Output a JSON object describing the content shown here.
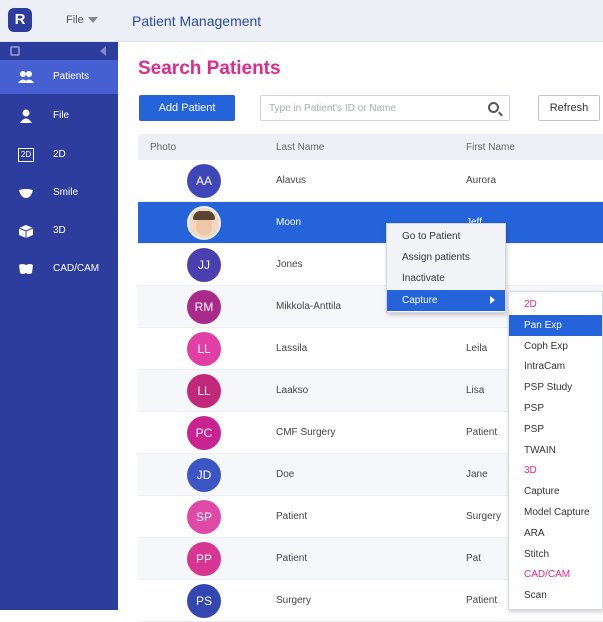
{
  "topbar": {
    "logo": "R",
    "file_menu": "File",
    "app_title": "Patient Management"
  },
  "sidebar": {
    "items": [
      {
        "label": "Patients",
        "icon": "people-icon",
        "active": true
      },
      {
        "label": "File",
        "icon": "person-icon",
        "active": false
      },
      {
        "label": "2D",
        "icon": "2d-icon",
        "active": false
      },
      {
        "label": "Smile",
        "icon": "smile-icon",
        "active": false
      },
      {
        "label": "3D",
        "icon": "3d-icon",
        "active": false
      },
      {
        "label": "CAD/CAM",
        "icon": "cadcam-icon",
        "active": false
      }
    ],
    "icon_text": {
      "2d": "2D"
    }
  },
  "main": {
    "title": "Search Patients",
    "add_patient_label": "Add Patient",
    "search_placeholder": "Type in Patient's ID or Name",
    "refresh_label": "Refresh",
    "columns": [
      "Photo",
      "Last Name",
      "First Name"
    ],
    "rows": [
      {
        "initials": "AA",
        "last": "Alavus",
        "first": "Aurora",
        "color": "#3f47b8"
      },
      {
        "initials": "",
        "last": "Moon",
        "first": "Jeff",
        "color": "#f4d7bf",
        "photo": true
      },
      {
        "initials": "JJ",
        "last": "Jones",
        "first": "",
        "color": "#4a3fb0"
      },
      {
        "initials": "RM",
        "last": "Mikkola-Anttila",
        "first": "",
        "color": "#a92a8a"
      },
      {
        "initials": "LL",
        "last": "Lassila",
        "first": "Leila",
        "color": "#e23fa6"
      },
      {
        "initials": "LL",
        "last": "Laakso",
        "first": "Lisa",
        "color": "#c2287a"
      },
      {
        "initials": "PC",
        "last": "CMF Surgery",
        "first": "Patient",
        "color": "#c92392"
      },
      {
        "initials": "JD",
        "last": "Doe",
        "first": "Jane",
        "color": "#3b56c4"
      },
      {
        "initials": "SP",
        "last": "Patient",
        "first": "Surgery",
        "color": "#e04aa6"
      },
      {
        "initials": "PP",
        "last": "Patient",
        "first": "Pat",
        "color": "#d83592"
      },
      {
        "initials": "PS",
        "last": "Surgery",
        "first": "Patient",
        "color": "#3446b0"
      }
    ]
  },
  "context_menu": {
    "items": [
      "Go to Patient",
      "Assign patients",
      "Inactivate",
      "Capture"
    ]
  },
  "capture_submenu": {
    "items": [
      {
        "label": "2D",
        "kind": "head"
      },
      {
        "label": "Pan Exp",
        "kind": "hl"
      },
      {
        "label": "Coph Exp",
        "kind": ""
      },
      {
        "label": "IntraCam",
        "kind": ""
      },
      {
        "label": "PSP Study",
        "kind": ""
      },
      {
        "label": "PSP",
        "kind": ""
      },
      {
        "label": "PSP",
        "kind": ""
      },
      {
        "label": "TWAIN",
        "kind": ""
      },
      {
        "label": "3D",
        "kind": "head"
      },
      {
        "label": "Capture",
        "kind": ""
      },
      {
        "label": "Model Capture",
        "kind": ""
      },
      {
        "label": "ARA",
        "kind": ""
      },
      {
        "label": "Stitch",
        "kind": ""
      },
      {
        "label": "CAD/CAM",
        "kind": "head"
      },
      {
        "label": "Scan",
        "kind": ""
      }
    ]
  },
  "colors": {
    "brand": "#2c3d9e",
    "accent": "#e02a8a",
    "primary": "#2463d9"
  }
}
